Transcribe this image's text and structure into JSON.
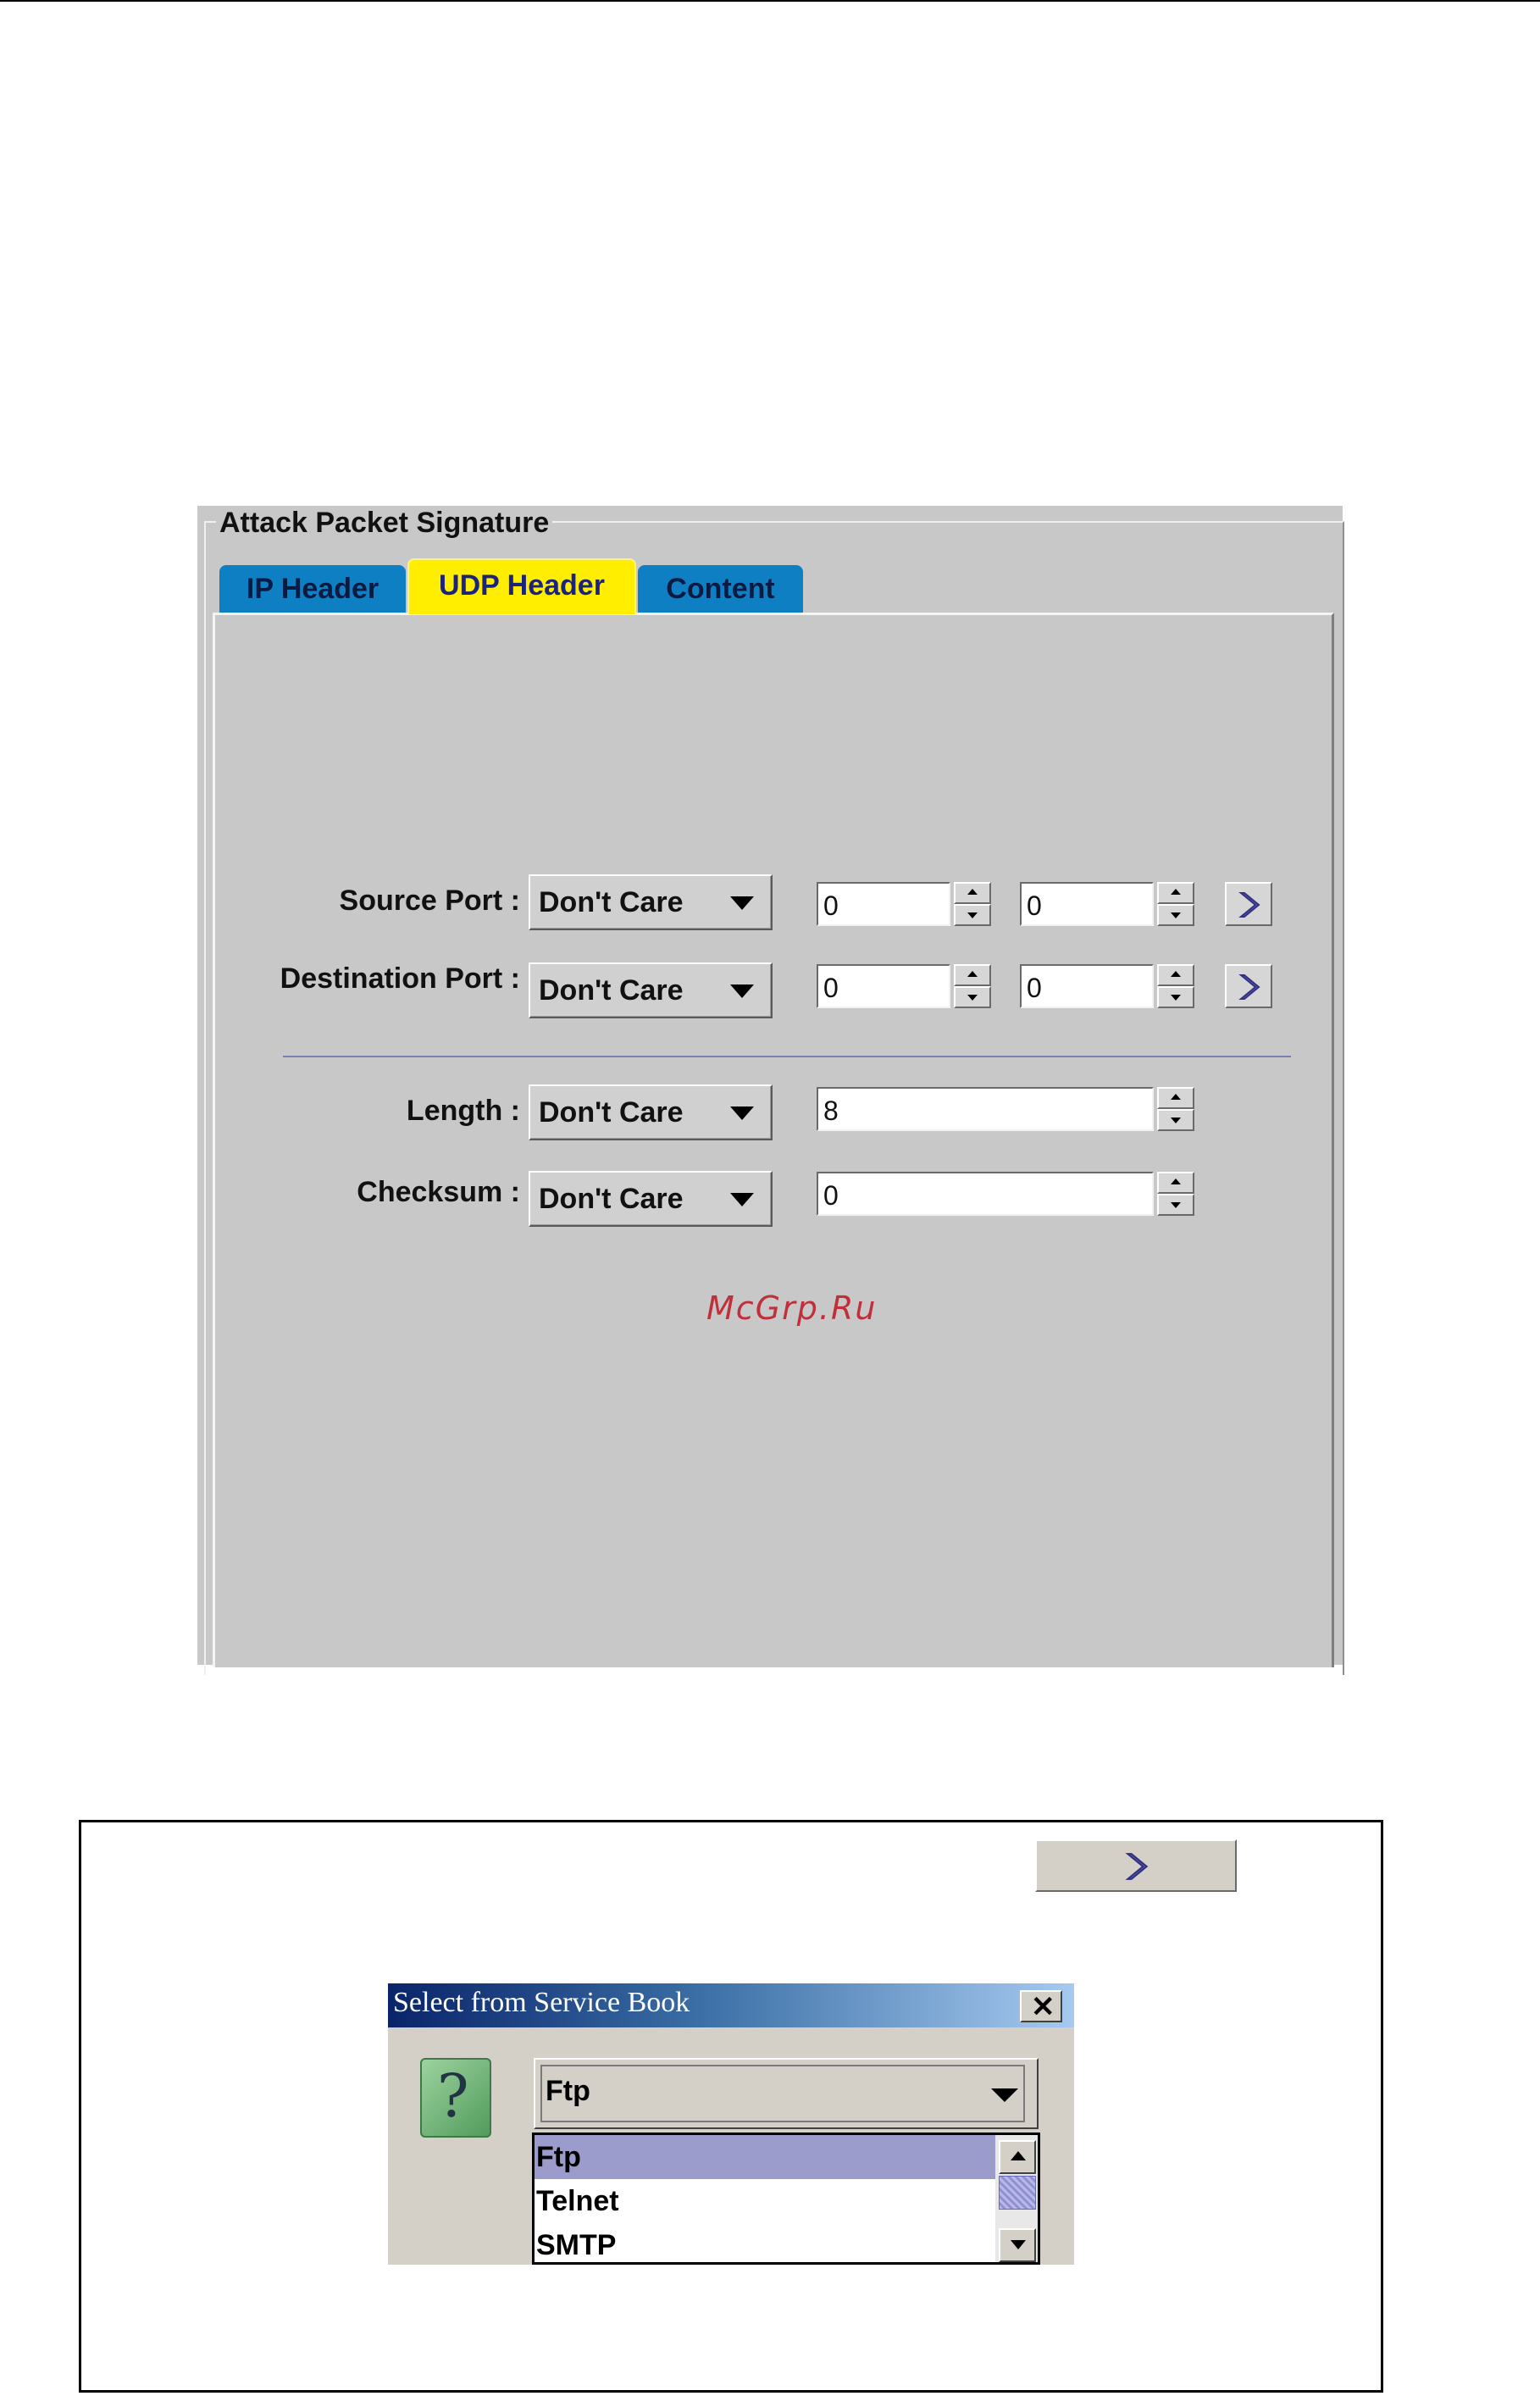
{
  "panel": {
    "group_title": "Attack Packet Signature",
    "tabs": [
      {
        "label": "IP Header",
        "active": false
      },
      {
        "label": "UDP Header",
        "active": true
      },
      {
        "label": "Content",
        "active": false
      }
    ],
    "fields": {
      "source_port": {
        "label": "Source Port :",
        "mode": "Don't Care",
        "from": "0",
        "to": "0"
      },
      "destination_port": {
        "label": "Destination Port :",
        "mode": "Don't Care",
        "from": "0",
        "to": "0"
      },
      "length": {
        "label": "Length :",
        "mode": "Don't Care",
        "value": "8"
      },
      "checksum": {
        "label": "Checksum :",
        "mode": "Don't Care",
        "value": "0"
      }
    },
    "watermark": "McGrp.Ru"
  },
  "dialog": {
    "title": "Select from Service Book",
    "selected": "Ftp",
    "list_items": [
      "Ftp",
      "Telnet",
      "SMTP"
    ]
  },
  "colors": {
    "panel_bg": "#c8c8c8",
    "tab_inactive": "#0f7fc4",
    "tab_active": "#ffee00",
    "list_selection": "#9c9ccc"
  },
  "icons": {
    "nav": "chevron-right-icon",
    "help": "question-mark-icon",
    "close": "close-icon"
  }
}
